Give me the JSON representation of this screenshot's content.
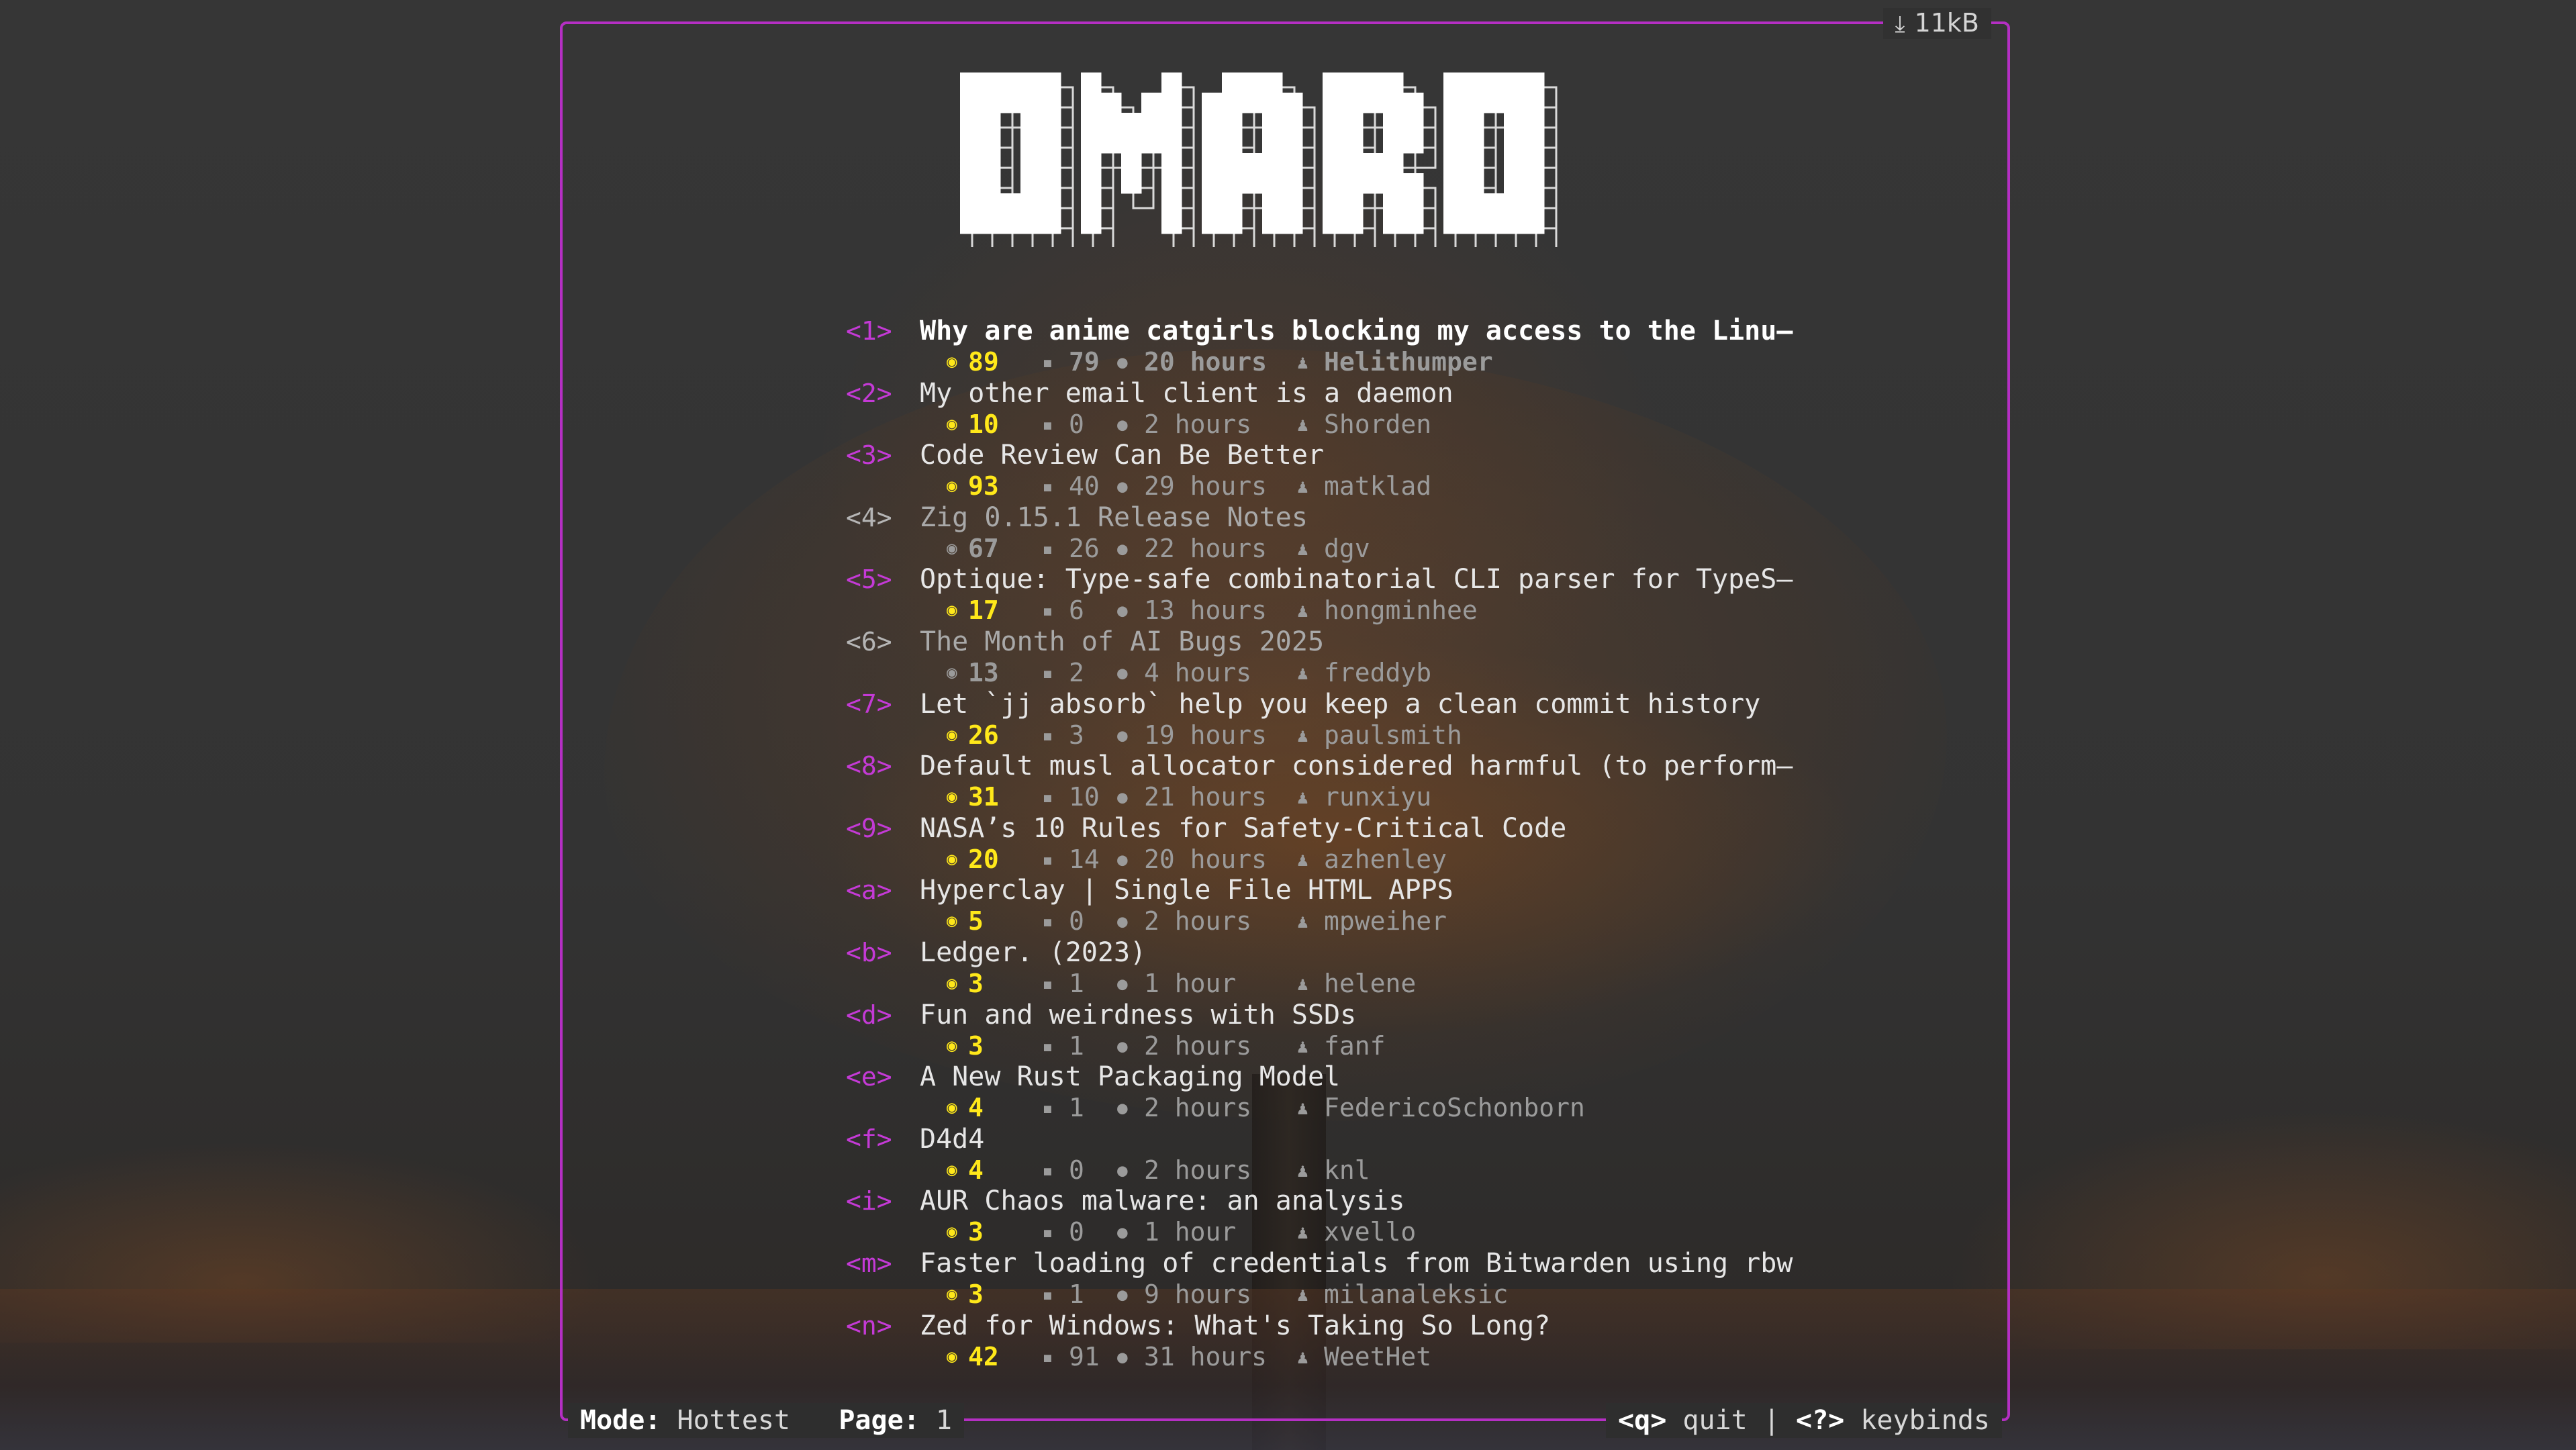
{
  "app": {
    "logo_text": "OMARO",
    "download_size": "11kB",
    "download_icon": "download-icon"
  },
  "stories": [
    {
      "key": "<1>",
      "title": "Why are anime catgirls blocking my access to the Linu—",
      "score": "89",
      "comments": "79",
      "age": "20 hours",
      "user": "Helithumper",
      "state": "selected"
    },
    {
      "key": "<2>",
      "title": "My other email client is a daemon",
      "score": "10",
      "comments": "0",
      "age": "2 hours",
      "user": "Shorden",
      "state": "unread"
    },
    {
      "key": "<3>",
      "title": "Code Review Can Be Better",
      "score": "93",
      "comments": "40",
      "age": "29 hours",
      "user": "matklad",
      "state": "unread"
    },
    {
      "key": "<4>",
      "title": "Zig 0.15.1 Release Notes",
      "score": "67",
      "comments": "26",
      "age": "22 hours",
      "user": "dgv",
      "state": "read"
    },
    {
      "key": "<5>",
      "title": "Optique: Type-safe combinatorial CLI parser for TypeS—",
      "score": "17",
      "comments": "6",
      "age": "13 hours",
      "user": "hongminhee",
      "state": "unread"
    },
    {
      "key": "<6>",
      "title": "The Month of AI Bugs 2025",
      "score": "13",
      "comments": "2",
      "age": "4 hours",
      "user": "freddyb",
      "state": "read"
    },
    {
      "key": "<7>",
      "title": "Let `jj absorb` help you keep a clean commit history",
      "score": "26",
      "comments": "3",
      "age": "19 hours",
      "user": "paulsmith",
      "state": "unread"
    },
    {
      "key": "<8>",
      "title": "Default musl allocator considered harmful (to perform—",
      "score": "31",
      "comments": "10",
      "age": "21 hours",
      "user": "runxiyu",
      "state": "unread"
    },
    {
      "key": "<9>",
      "title": "NASA’s 10 Rules for Safety-Critical Code",
      "score": "20",
      "comments": "14",
      "age": "20 hours",
      "user": "azhenley",
      "state": "unread"
    },
    {
      "key": "<a>",
      "title": "Hyperclay | Single File HTML APPS",
      "score": "5",
      "comments": "0",
      "age": "2 hours",
      "user": "mpweiher",
      "state": "unread"
    },
    {
      "key": "<b>",
      "title": "Ledger. (2023)",
      "score": "3",
      "comments": "1",
      "age": "1 hour",
      "user": "helene",
      "state": "unread"
    },
    {
      "key": "<d>",
      "title": "Fun and weirdness with SSDs",
      "score": "3",
      "comments": "1",
      "age": "2 hours",
      "user": "fanf",
      "state": "unread"
    },
    {
      "key": "<e>",
      "title": "A New Rust Packaging Model",
      "score": "4",
      "comments": "1",
      "age": "2 hours",
      "user": "FedericoSchonborn",
      "state": "unread"
    },
    {
      "key": "<f>",
      "title": "D4d4",
      "score": "4",
      "comments": "0",
      "age": "2 hours",
      "user": "knl",
      "state": "unread"
    },
    {
      "key": "<i>",
      "title": "AUR Chaos malware: an analysis",
      "score": "3",
      "comments": "0",
      "age": "1 hour",
      "user": "xvello",
      "state": "unread"
    },
    {
      "key": "<m>",
      "title": "Faster loading of credentials from Bitwarden using rbw",
      "score": "3",
      "comments": "1",
      "age": "9 hours",
      "user": "milanaleksic",
      "state": "unread"
    },
    {
      "key": "<n>",
      "title": "Zed for Windows: What's Taking So Long?",
      "score": "42",
      "comments": "91",
      "age": "31 hours",
      "user": "WeetHet",
      "state": "unread"
    }
  ],
  "status": {
    "mode_label": "Mode:",
    "mode_value": "Hottest",
    "page_label": "Page:",
    "page_value": "1",
    "quit_key": "<q>",
    "quit_label": "quit",
    "separator": "|",
    "keybinds_key": "<?>",
    "keybinds_label": "keybinds"
  },
  "colors": {
    "accent": "#b52fc4",
    "key": "#c43ad6",
    "score": "#ffe81a",
    "text": "#e6e6e6",
    "muted": "#9b9b9b",
    "background": "#2f2f2f"
  }
}
